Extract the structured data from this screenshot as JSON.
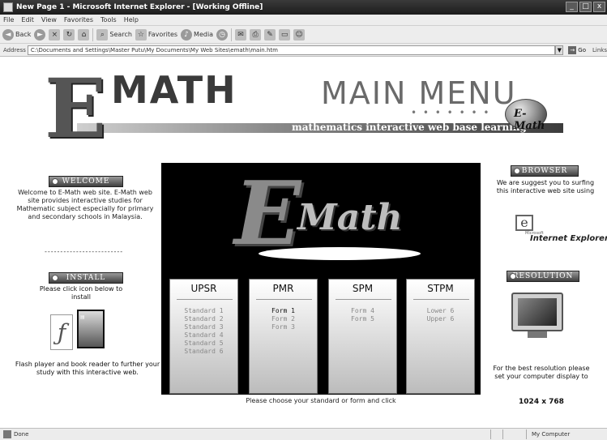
{
  "window": {
    "title": "New Page 1 - Microsoft Internet Explorer - [Working Offline]",
    "controls": [
      "_",
      "□",
      "x"
    ]
  },
  "menu": [
    "File",
    "Edit",
    "View",
    "Favorites",
    "Tools",
    "Help"
  ],
  "toolbar": {
    "back": "Back",
    "search": "Search",
    "favorites": "Favorites",
    "media": "Media"
  },
  "address": {
    "label": "Address",
    "value": "C:\\Documents and Settings\\Master Putu\\My Documents\\My Web Sites\\emath\\main.htm",
    "go": "Go",
    "links": "Links"
  },
  "status": {
    "text": "Done",
    "zone": "My Computer"
  },
  "header": {
    "logo_e": "E",
    "logo_math": "MATH",
    "main_menu": "MAIN MENU",
    "tagline": "mathematics interactive web base learning",
    "badge": "E-Math",
    "dots": "• • • • • • •"
  },
  "left": {
    "welcome_label": "WELCOME",
    "welcome_text": "Welcome to E-Math web site. E-Math web site provides interactive studies for Mathematic subject especially for primary and secondary schools in Malaysia.",
    "divider": "-------------------------",
    "install_label": "INSTALL",
    "install_text": "Please click icon below to install",
    "install_note": "Flash player and book reader to further your study with this interactive web."
  },
  "center": {
    "logo_e": "E",
    "logo_math": "Math",
    "levels": [
      {
        "title": "UPSR",
        "items": [
          "Standard 1",
          "Standard 2",
          "Standard 3",
          "Standard 4",
          "Standard 5",
          "Standard 6"
        ],
        "selected": -1
      },
      {
        "title": "PMR",
        "items": [
          "Form 1",
          "Form 2",
          "Form 3"
        ],
        "selected": 0
      },
      {
        "title": "SPM",
        "items": [
          "Form 4",
          "Form 5"
        ],
        "selected": -1
      },
      {
        "title": "STPM",
        "items": [
          "Lower 6",
          "Upper 6"
        ],
        "selected": -1
      }
    ],
    "instruction": "Please choose your standard or form and click"
  },
  "right": {
    "browser_label": "BROWSER",
    "browser_text": "We are suggest you to surfing this interactive web site using",
    "ie_ms": "Microsoft",
    "ie_label": "Internet Explorer",
    "resolution_label": "RESOLUTION",
    "resolution_text": "For the best resolution please set your computer display to",
    "resolution_value": "1024 x 768"
  }
}
